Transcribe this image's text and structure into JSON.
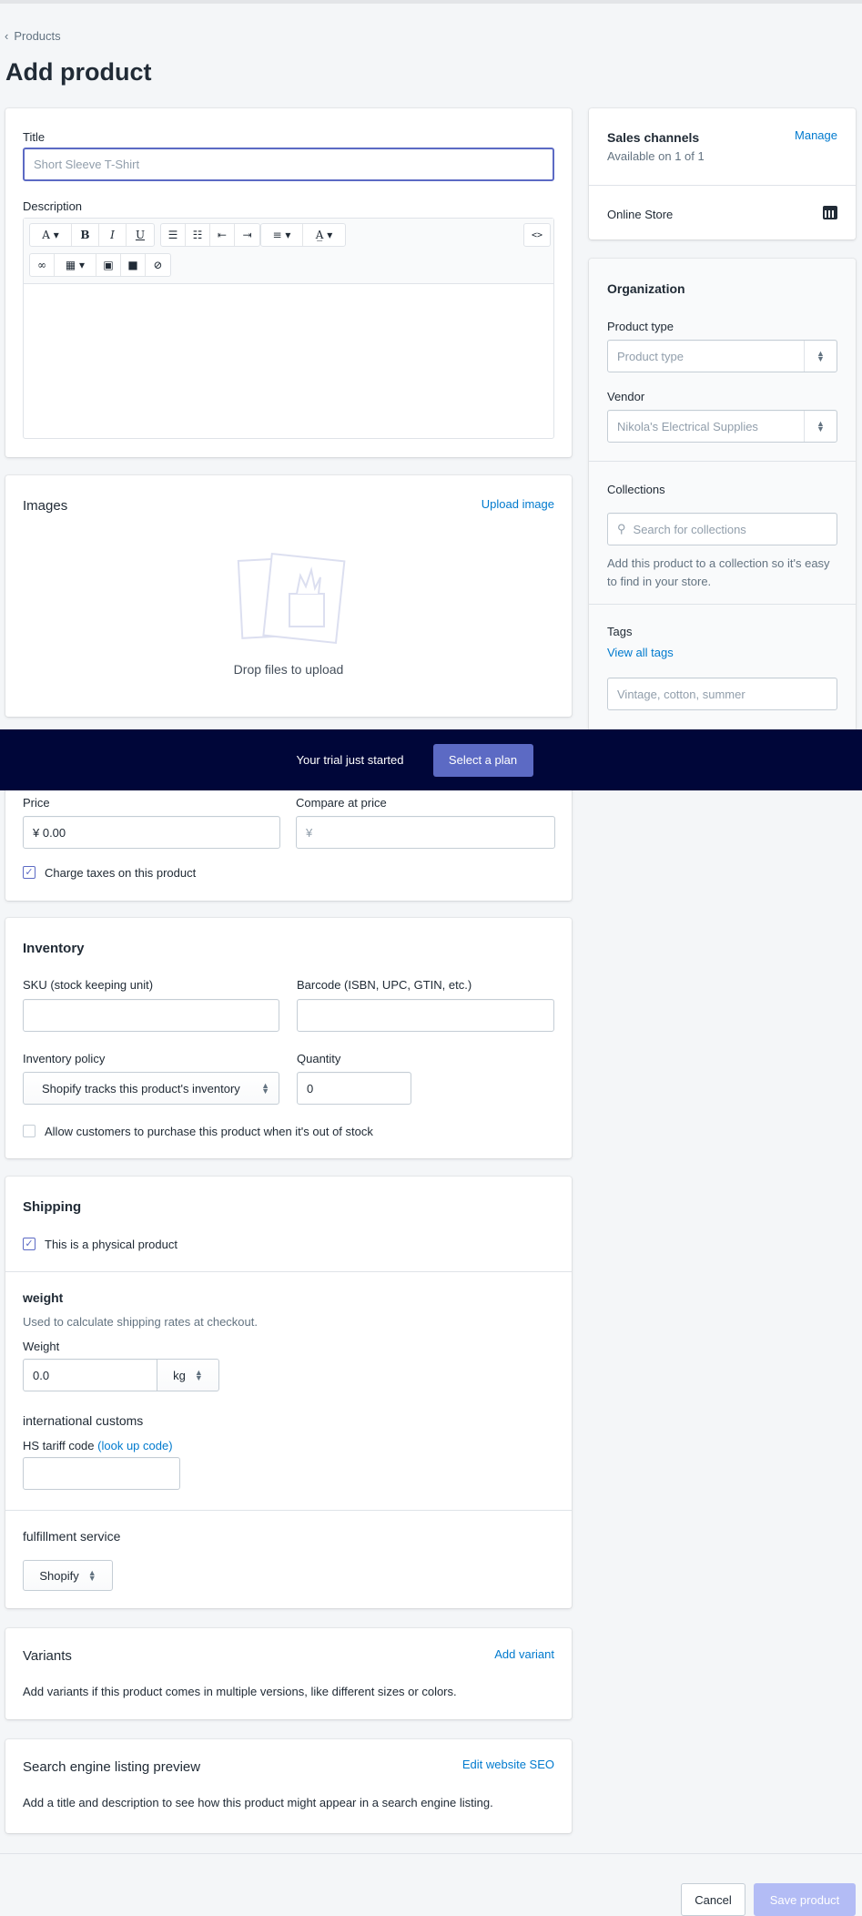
{
  "breadcrumb": {
    "label": "Products"
  },
  "page_title": "Add product",
  "product": {
    "title_label": "Title",
    "title_placeholder": "Short Sleeve T-Shirt",
    "description_label": "Description",
    "toolbar": [
      "A",
      "B",
      "I",
      "U",
      "bullets",
      "numbers",
      "outdent",
      "indent",
      "align",
      "color",
      "<>",
      "link",
      "table",
      "image",
      "video",
      "clear"
    ]
  },
  "images": {
    "heading": "Images",
    "upload": "Upload image",
    "drop": "Drop files to upload"
  },
  "banner": {
    "text": "Your trial just started",
    "button": "Select a plan",
    "bg": "#000639",
    "accent": "#5c6ac4"
  },
  "pricing": {
    "price_label": "Price",
    "price_value": "¥ 0.00",
    "compare_label": "Compare at price",
    "compare_placeholder": "¥",
    "taxes": "Charge taxes on this product",
    "taxes_checked": true
  },
  "inventory": {
    "heading": "Inventory",
    "sku_label": "SKU (stock keeping unit)",
    "barcode_label": "Barcode (ISBN, UPC, GTIN, etc.)",
    "policy_label": "Inventory policy",
    "policy_value": "Shopify tracks this product's inventory",
    "quantity_label": "Quantity",
    "quantity_value": "0",
    "allow": "Allow customers to purchase this product when it's out of stock",
    "allow_checked": false
  },
  "shipping": {
    "heading": "Shipping",
    "physical": "This is a physical product",
    "physical_checked": true,
    "weight_heading": "weight",
    "weight_help": "Used to calculate shipping rates at checkout.",
    "weight_label": "Weight",
    "weight_value": "0.0",
    "weight_unit": "kg",
    "customs_heading": "international customs",
    "hs_label": "HS tariff code",
    "hs_link": "(look up code)",
    "fulfillment_heading": "fulfillment service",
    "fulfillment_value": "Shopify"
  },
  "variants": {
    "heading": "Variants",
    "link": "Add variant",
    "text": "Add variants if this product comes in multiple versions, like different sizes or colors."
  },
  "seo": {
    "heading": "Search engine listing preview",
    "link": "Edit website SEO",
    "text": "Add a title and description to see how this product might appear in a search engine listing."
  },
  "sales": {
    "heading": "Sales channels",
    "manage": "Manage",
    "available": "Available on 1 of 1",
    "channel": "Online Store"
  },
  "organization": {
    "heading": "Organization",
    "type_label": "Product type",
    "type_placeholder": "Product type",
    "vendor_label": "Vendor",
    "vendor_placeholder": "Nikola's Electrical Supplies",
    "collections_label": "Collections",
    "collections_placeholder": "Search for collections",
    "collections_help": "Add this product to a collection so it's easy to find in your store.",
    "tags_label": "Tags",
    "tags_link": "View all tags",
    "tags_placeholder": "Vintage, cotton, summer"
  },
  "footer": {
    "cancel": "Cancel",
    "save": "Save product"
  }
}
